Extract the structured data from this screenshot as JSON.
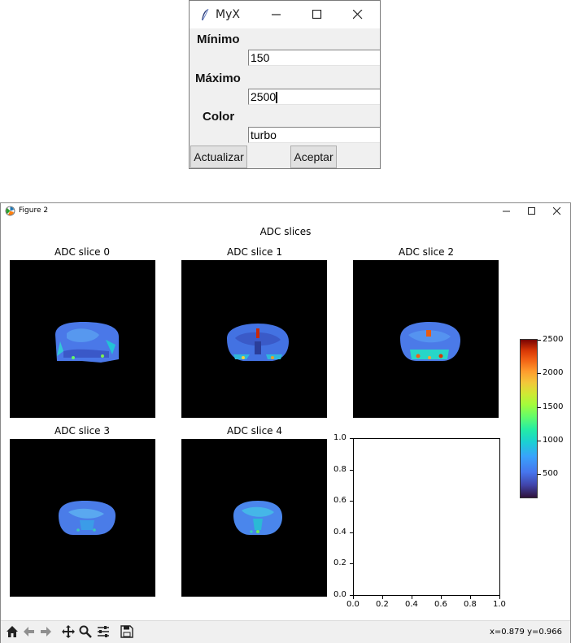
{
  "dialog": {
    "title": "MyX",
    "label_min": "Mínimo",
    "min_value": "150",
    "label_max": "Máximo",
    "max_value": "2500",
    "label_color": "Color",
    "color_value": "turbo",
    "update_button": "Actualizar",
    "accept_button": "Aceptar"
  },
  "figure": {
    "window_title": "Figure 2",
    "suptitle": "ADC slices",
    "colormap": "turbo",
    "colorbar_ticks": [
      "2500",
      "2000",
      "1500",
      "1000",
      "500"
    ],
    "status_coords": "x=0.879 y=0.966"
  },
  "chart_data": [
    {
      "type": "heatmap",
      "title": "ADC slice 0",
      "colormap": "turbo",
      "clim": [
        150,
        2500
      ]
    },
    {
      "type": "heatmap",
      "title": "ADC slice 1",
      "colormap": "turbo",
      "clim": [
        150,
        2500
      ]
    },
    {
      "type": "heatmap",
      "title": "ADC slice 2",
      "colormap": "turbo",
      "clim": [
        150,
        2500
      ]
    },
    {
      "type": "heatmap",
      "title": "ADC slice 3",
      "colormap": "turbo",
      "clim": [
        150,
        2500
      ]
    },
    {
      "type": "heatmap",
      "title": "ADC slice 4",
      "colormap": "turbo",
      "clim": [
        150,
        2500
      ]
    },
    {
      "type": "scatter",
      "title": "",
      "xlim": [
        0.0,
        1.0
      ],
      "ylim": [
        0.0,
        1.0
      ],
      "xticks": [
        "0.0",
        "0.2",
        "0.4",
        "0.6",
        "0.8",
        "1.0"
      ],
      "yticks": [
        "0.0",
        "0.2",
        "0.4",
        "0.6",
        "0.8",
        "1.0"
      ],
      "series": []
    }
  ]
}
